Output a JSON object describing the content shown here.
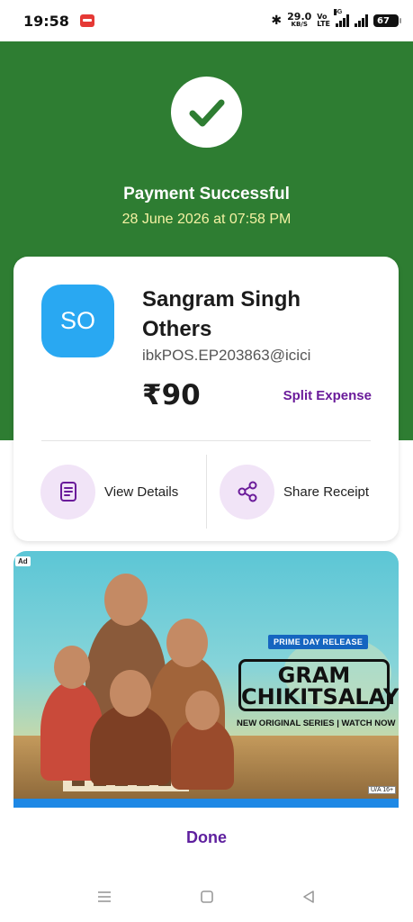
{
  "status_bar": {
    "time": "19:58",
    "net_speed_value": "29.0",
    "net_speed_unit": "KB/S",
    "volte_top": "Vo",
    "volte_bottom": "LTE",
    "signal_tag": "5G",
    "battery": "67"
  },
  "header": {
    "title": "Payment Successful",
    "date": "28 June 2026 at 07:58 PM",
    "bg_color": "#2e7d32"
  },
  "payment": {
    "avatar_initials": "SO",
    "payee_name": "Sangram Singh Others",
    "upi_id": "ibkPOS.EP203863@icici",
    "amount": "₹90",
    "split_label": "Split Expense"
  },
  "actions": {
    "view_details": "View Details",
    "share_receipt": "Share Receipt"
  },
  "ad": {
    "tag": "Ad",
    "badge": "PRIME DAY RELEASE",
    "title_line1": "GRAM",
    "title_line2": "CHIKITSALAY",
    "subtitle": "NEW ORIGINAL SERIES | WATCH NOW",
    "rating": "U/A 16+"
  },
  "footer": {
    "done_label": "Done",
    "accent_color": "#5e1f9e"
  },
  "icons": [
    "check-icon",
    "bluetooth-icon",
    "document-icon",
    "share-icon",
    "menu-icon",
    "home-icon",
    "back-icon"
  ]
}
